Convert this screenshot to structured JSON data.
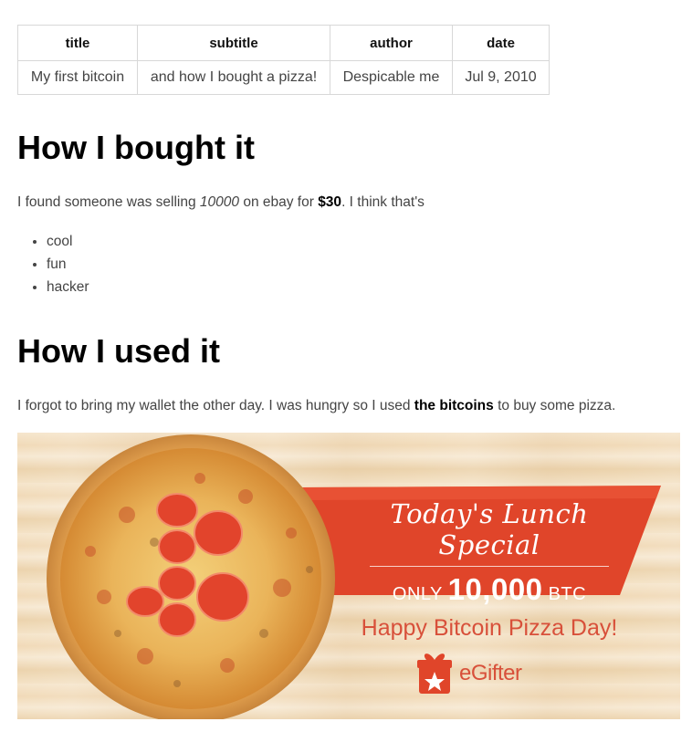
{
  "meta_table": {
    "headers": [
      "title",
      "subtitle",
      "author",
      "date"
    ],
    "row": [
      "My first bitcoin",
      "and how I bought a pizza!",
      "Despicable me",
      "Jul 9, 2010"
    ]
  },
  "section1": {
    "heading": "How I bought it",
    "para": {
      "t1": "I found someone was selling ",
      "em": "10000",
      "t2": " on ebay for ",
      "strong": "$30",
      "t3": ". I think that's"
    },
    "list": [
      "cool",
      "fun",
      "hacker"
    ]
  },
  "section2": {
    "heading": "How I used it",
    "para": {
      "t1": "I forgot to bring my wallet the other day. I was hungry so I used ",
      "strong": "the bitcoins",
      "t2": " to buy some pizza."
    }
  },
  "banner": {
    "title": "Today's Lunch Special",
    "price_prefix": "ONLY",
    "price_amount": "10,000",
    "price_unit": "BTC",
    "tagline": "Happy Bitcoin Pizza Day!",
    "brand": "eGifter",
    "colors": {
      "ribbon": "#e0452a",
      "text_red": "#d8503a",
      "wood": "#f3e1c4"
    }
  }
}
